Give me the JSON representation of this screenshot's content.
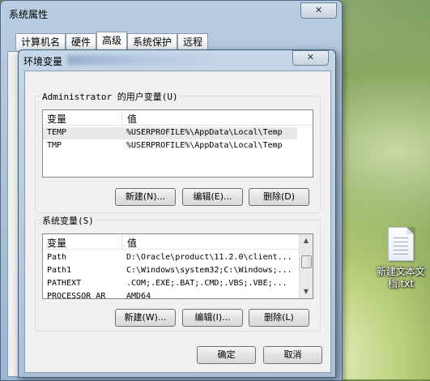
{
  "system_properties": {
    "title": "系统属性",
    "close_glyph": "✕",
    "tabs": [
      "计算机名",
      "硬件",
      "高级",
      "系统保护",
      "远程"
    ]
  },
  "env_dialog": {
    "title": "环境变量",
    "close_glyph": "✕",
    "user_group_title": "Administrator 的用户变量(U)",
    "columns": {
      "name": "变量",
      "value": "值"
    },
    "user_vars": [
      {
        "name": "TEMP",
        "value": "%USERPROFILE%\\AppData\\Local\\Temp"
      },
      {
        "name": "TMP",
        "value": "%USERPROFILE%\\AppData\\Local\\Temp"
      }
    ],
    "user_buttons": {
      "new": "新建(N)...",
      "edit": "编辑(E)...",
      "delete": "删除(D)"
    },
    "system_group_title": "系统变量(S)",
    "system_vars": [
      {
        "name": "Path",
        "value": "D:\\Oracle\\product\\11.2.0\\client..."
      },
      {
        "name": "Path1",
        "value": "C:\\Windows\\system32;C:\\Windows;..."
      },
      {
        "name": "PATHEXT",
        "value": ".COM;.EXE;.BAT;.CMD;.VBS;.VBE;..."
      },
      {
        "name": "PROCESSOR_AR",
        "value": "AMD64"
      }
    ],
    "system_buttons": {
      "new": "新建(W)...",
      "edit": "编辑(I)...",
      "delete": "删除(L)"
    },
    "ok": "确定",
    "cancel": "取消"
  },
  "desktop": {
    "icon_label_line1": "新建文本文",
    "icon_label_line2": "档.txt",
    "icon_name": "text-file-icon"
  }
}
